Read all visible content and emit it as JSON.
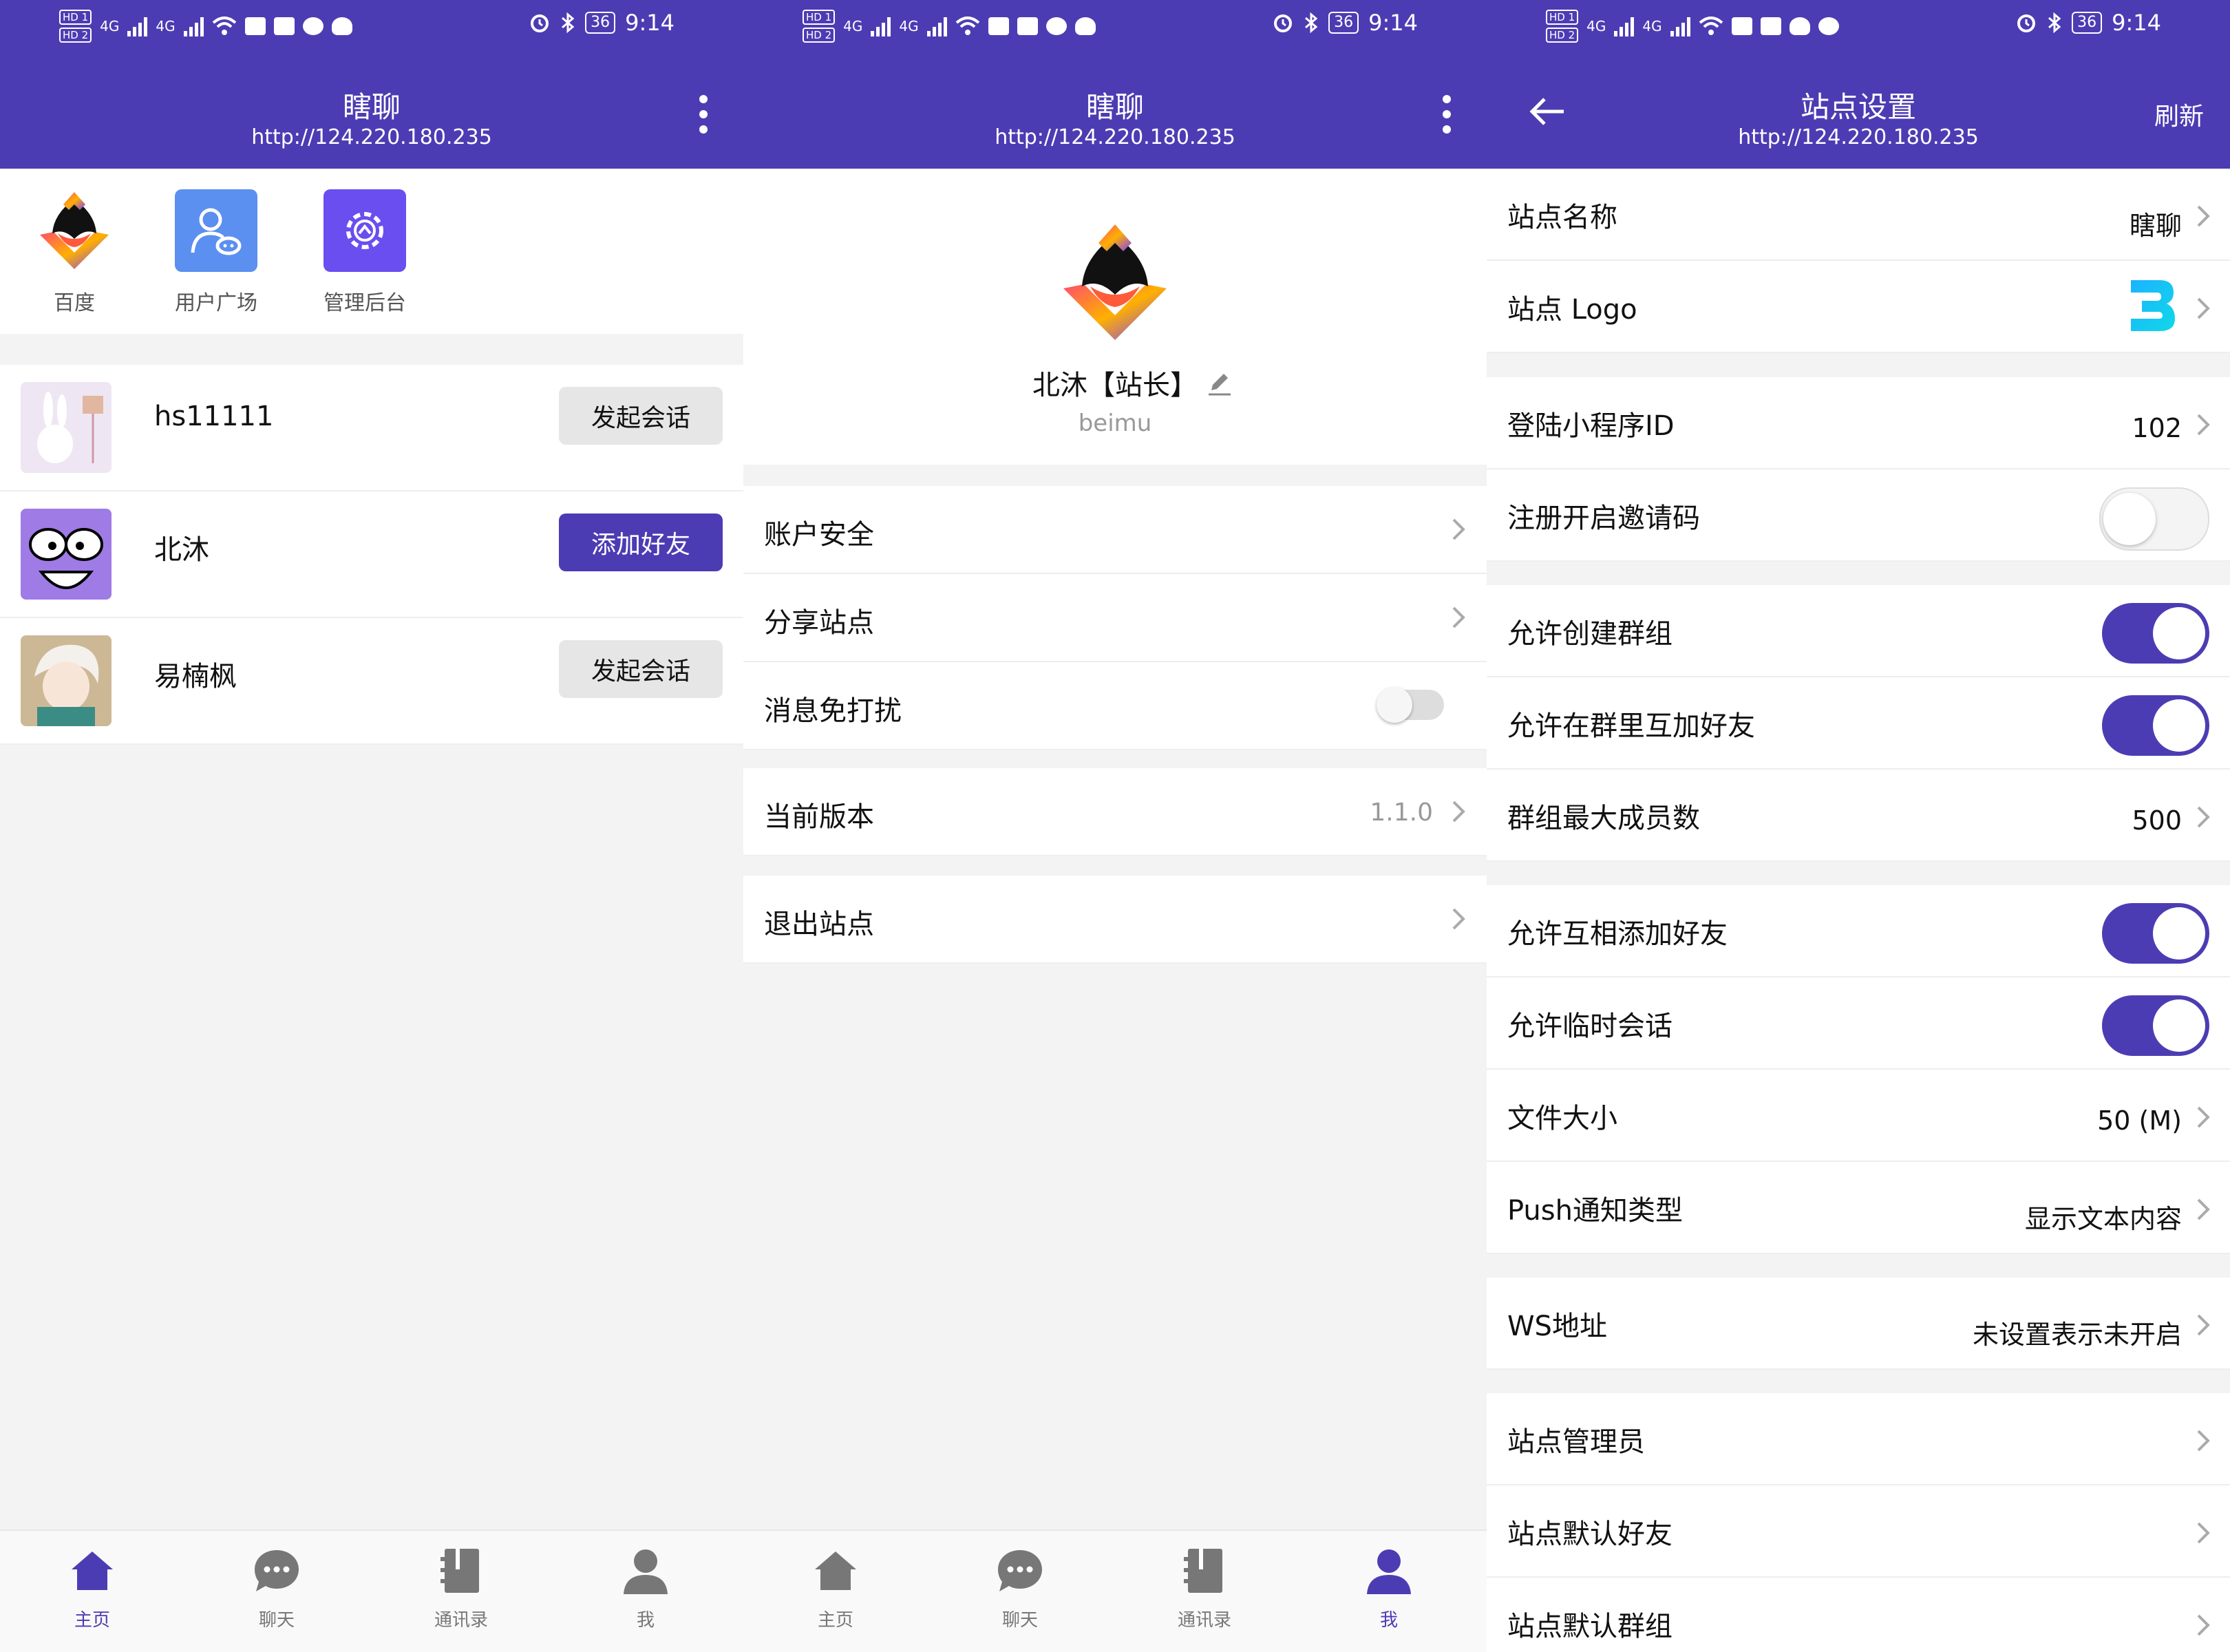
{
  "status": {
    "time": "9:14",
    "battery": "36",
    "hd1": "HD 1",
    "hd2": "HD 2",
    "net1": "4G",
    "net2": "4G"
  },
  "app": {
    "title": "瞎聊",
    "url": "http://124.220.180.235"
  },
  "home": {
    "apps": [
      {
        "label": "百度",
        "icon": "baidu-logo-icon"
      },
      {
        "label": "用户广场",
        "icon": "user-plaza-icon"
      },
      {
        "label": "管理后台",
        "icon": "admin-gear-icon"
      }
    ],
    "users": [
      {
        "name": "hs11111",
        "action": "发起会话",
        "style": "gray"
      },
      {
        "name": "北沐",
        "action": "添加好友",
        "style": "purple"
      },
      {
        "name": "易楠枫",
        "action": "发起会话",
        "style": "gray"
      }
    ]
  },
  "nav": {
    "home": "主页",
    "chat": "聊天",
    "contacts": "通讯录",
    "me": "我"
  },
  "me": {
    "name": "北沐【站长】",
    "username": "beimu",
    "menu": {
      "account_security": "账户安全",
      "share_site": "分享站点",
      "mute": "消息免打扰",
      "version_label": "当前版本",
      "version_value": "1.1.0",
      "exit": "退出站点"
    }
  },
  "settings": {
    "title": "站点设置",
    "refresh": "刷新",
    "rows": {
      "site_name": {
        "label": "站点名称",
        "value": "瞎聊"
      },
      "site_logo": {
        "label": "站点 Logo"
      },
      "miniprogram_id": {
        "label": "登陆小程序ID",
        "value": "102"
      },
      "invite_code": {
        "label": "注册开启邀请码",
        "on": false
      },
      "create_group": {
        "label": "允许创建群组",
        "on": true
      },
      "group_add_friend": {
        "label": "允许在群里互加好友",
        "on": true
      },
      "group_max": {
        "label": "群组最大成员数",
        "value": "500"
      },
      "mutual_add": {
        "label": "允许互相添加好友",
        "on": true
      },
      "temp_chat": {
        "label": "允许临时会话",
        "on": true
      },
      "file_size": {
        "label": "文件大小",
        "value": "50 (M)"
      },
      "push_type": {
        "label": "Push通知类型",
        "value": "显示文本内容"
      },
      "ws_address": {
        "label": "WS地址",
        "value": "未设置表示未开启"
      },
      "admins": {
        "label": "站点管理员"
      },
      "default_friends": {
        "label": "站点默认好友"
      },
      "default_groups": {
        "label": "站点默认群组"
      }
    }
  },
  "colors": {
    "primary": "#4c3cb3",
    "background": "#f3f3f3"
  }
}
